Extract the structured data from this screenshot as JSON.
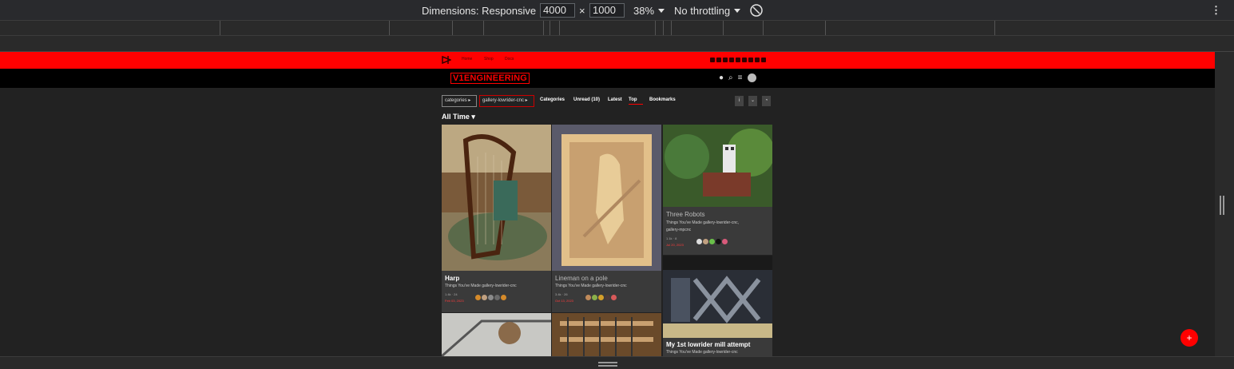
{
  "devtools": {
    "dimensions_label": "Dimensions: Responsive",
    "width_value": "4000",
    "times": "×",
    "height_value": "1000",
    "zoom": "38%",
    "throttling": "No throttling"
  },
  "site": {
    "top_nav": [
      "Home",
      "Shop",
      "Docs"
    ],
    "brand": "V1ENGINEERING",
    "breadcrumbs": [
      "categories",
      "gallery-lowrider-cnc"
    ],
    "nav_links": [
      "Categories",
      "Unread (10)",
      "Latest",
      "Top",
      "Bookmarks"
    ],
    "active_link": "Top",
    "period": "All Time",
    "fab": "+"
  },
  "cards": [
    {
      "title": "Harp",
      "category": "Things You've Made gallery-lowrider-cnc",
      "meta": "1.4k · 24",
      "date": "Feb 03, 2023"
    },
    {
      "title": "Lineman on a pole",
      "category": "Things You've Made gallery-lowrider-cnc",
      "meta": "3.4k · 26",
      "date": "Oct 13, 2023"
    },
    {
      "title": "Three Robots",
      "category": "Things You've Made gallery-lowrider-cnc,",
      "category2": "gallery-mpcnc",
      "meta": "1.1k · 8",
      "date": "Jul 20, 2023"
    },
    {
      "title": "My 1st lowrider mill attempt",
      "category": "Things You've Made gallery-lowrider-cnc"
    }
  ],
  "colors": {
    "accent": "#ff0000",
    "header_bg": "#000000",
    "page_bg": "#222222",
    "card_bg": "#3a3a3a"
  }
}
